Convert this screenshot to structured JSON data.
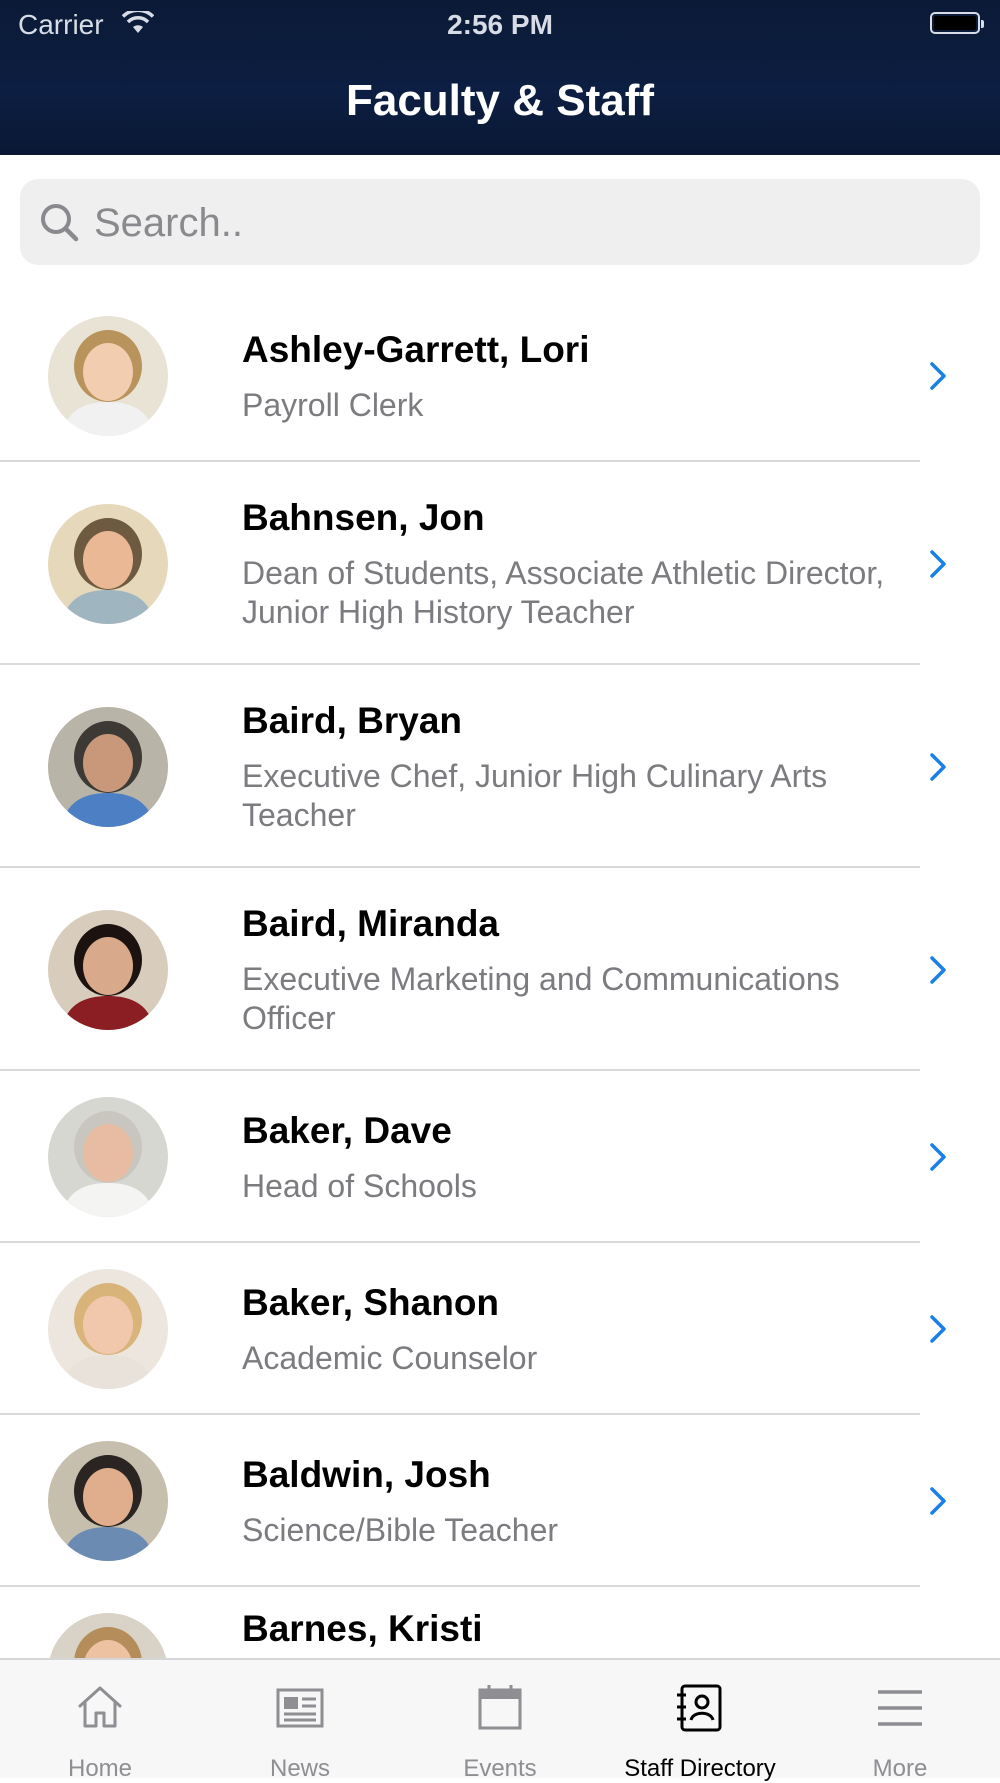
{
  "status_bar": {
    "carrier": "Carrier",
    "time": "2:56 PM"
  },
  "header": {
    "title": "Faculty & Staff"
  },
  "search": {
    "placeholder": "Search.."
  },
  "staff": [
    {
      "name": "Ashley-Garrett, Lori",
      "role": "Payroll Clerk"
    },
    {
      "name": "Bahnsen, Jon",
      "role": "Dean of Students, Associate Athletic Director, Junior High History Teacher"
    },
    {
      "name": "Baird, Bryan",
      "role": "Executive Chef, Junior High Culinary Arts Teacher"
    },
    {
      "name": "Baird, Miranda",
      "role": "Executive Marketing and Communications Officer"
    },
    {
      "name": "Baker, Dave",
      "role": "Head of Schools"
    },
    {
      "name": "Baker, Shanon",
      "role": "Academic Counselor"
    },
    {
      "name": "Baldwin, Josh",
      "role": "Science/Bible Teacher"
    },
    {
      "name": "Barnes, Kristi",
      "role": ""
    }
  ],
  "tabs": [
    {
      "label": "Home",
      "icon": "home-icon"
    },
    {
      "label": "News",
      "icon": "news-icon"
    },
    {
      "label": "Events",
      "icon": "calendar-icon"
    },
    {
      "label": "Staff Directory",
      "icon": "staff-directory-icon"
    },
    {
      "label": "More",
      "icon": "menu-icon"
    }
  ],
  "active_tab": "Staff Directory",
  "colors": {
    "accent": "#1a7fe6",
    "header_bg": "#0c1e42"
  }
}
